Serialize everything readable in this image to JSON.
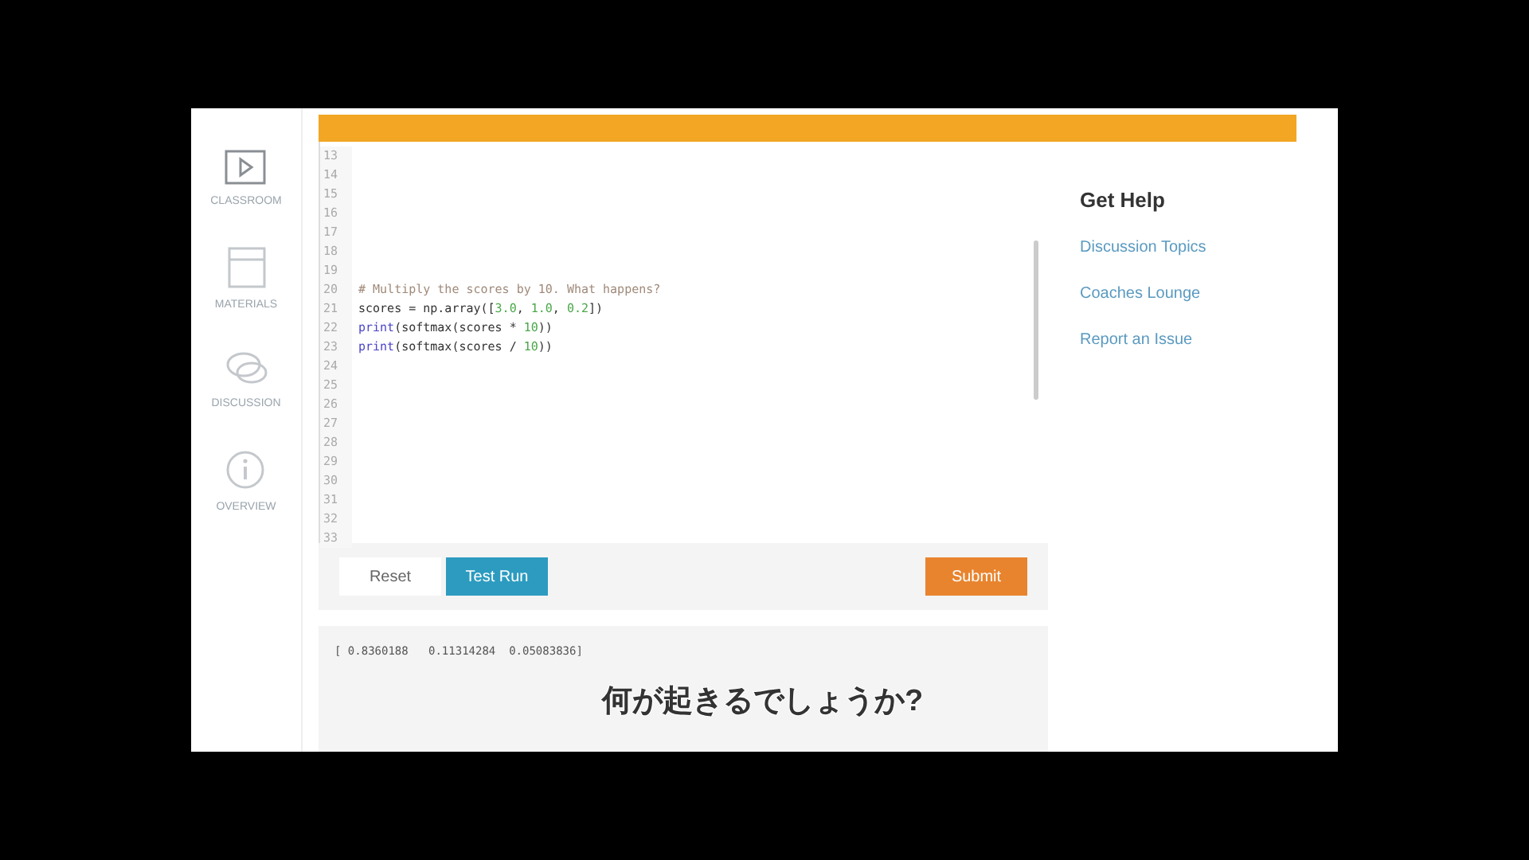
{
  "sidebar": {
    "items": [
      {
        "label": "CLASSROOM"
      },
      {
        "label": "MATERIALS"
      },
      {
        "label": "DISCUSSION"
      },
      {
        "label": "OVERVIEW"
      }
    ]
  },
  "editor": {
    "lines": [
      {
        "number": "13"
      },
      {
        "number": "14"
      },
      {
        "number": "15"
      },
      {
        "number": "16"
      },
      {
        "number": "17"
      },
      {
        "number": "18"
      },
      {
        "number": "19"
      },
      {
        "number": "20",
        "tokens": [
          {
            "text": "# Multiply the scores by 10. What happens?",
            "kind": "comment"
          }
        ]
      },
      {
        "number": "21",
        "tokens": [
          {
            "text": "scores = np.array([",
            "kind": "plain"
          },
          {
            "text": "3.0",
            "kind": "number"
          },
          {
            "text": ", ",
            "kind": "plain"
          },
          {
            "text": "1.0",
            "kind": "number"
          },
          {
            "text": ", ",
            "kind": "plain"
          },
          {
            "text": "0.2",
            "kind": "number"
          },
          {
            "text": "])",
            "kind": "plain"
          }
        ]
      },
      {
        "number": "22",
        "tokens": [
          {
            "text": "print",
            "kind": "keyword"
          },
          {
            "text": "(softmax(scores * ",
            "kind": "plain"
          },
          {
            "text": "10",
            "kind": "number"
          },
          {
            "text": "))",
            "kind": "plain"
          }
        ]
      },
      {
        "number": "23",
        "tokens": [
          {
            "text": "print",
            "kind": "keyword"
          },
          {
            "text": "(softmax(scores / ",
            "kind": "plain"
          },
          {
            "text": "10",
            "kind": "number"
          },
          {
            "text": "))",
            "kind": "plain"
          }
        ]
      },
      {
        "number": "24"
      },
      {
        "number": "25"
      },
      {
        "number": "26"
      },
      {
        "number": "27"
      },
      {
        "number": "28"
      },
      {
        "number": "29"
      },
      {
        "number": "30"
      },
      {
        "number": "31"
      },
      {
        "number": "32"
      },
      {
        "number": "33"
      }
    ]
  },
  "buttons": [
    {
      "label": "Reset",
      "kind": "plain"
    },
    {
      "label": "Test Run",
      "kind": "run"
    },
    {
      "label": "Submit",
      "kind": "submit"
    }
  ],
  "output": "[ 0.8360188   0.11314284  0.05083836]",
  "help": {
    "title": "Get Help",
    "links": [
      "Discussion Topics",
      "Coaches Lounge",
      "Report an Issue"
    ]
  },
  "caption": "何が起きるでしょうか?"
}
